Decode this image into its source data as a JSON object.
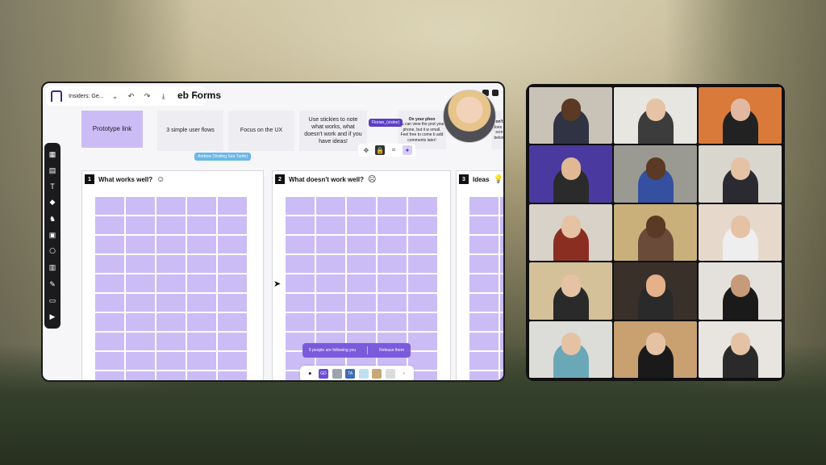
{
  "board": {
    "app_title": "Insiders: Ge...",
    "board_title": "eb Forms",
    "stickies": {
      "prototype_link": "Prototype link",
      "user_flows": "3 simple user flows",
      "focus_ux": "Focus on the UX",
      "use_stickies": "Use stickies to note what works, what doesn't work and if you have ideas!",
      "phone_a": "On your phon",
      "phone_b": "ou can view the prot your phone, but it w small. Feel free to come b add comments later!",
      "partial_a": "on't",
      "partial_b": "Joes e scre below"
    },
    "cursor_labels": {
      "andrew": "Andrew (Visiting Sea Turtle)",
      "florian": "Florian_(visitor)"
    },
    "columns": [
      {
        "num": "1",
        "title": "What works well?",
        "emoji": "☺"
      },
      {
        "num": "2",
        "title": "What doesn't work well?",
        "emoji": "☹"
      },
      {
        "num": "3",
        "title": "Ideas",
        "emoji": "💡"
      }
    ],
    "follow_banner": {
      "text": "5 people are following you",
      "action": "Release them"
    },
    "avatars": [
      "☻",
      "GD",
      "",
      "TA",
      "",
      "",
      "",
      "›"
    ]
  },
  "colors": {
    "accent": "#7a5bdb",
    "sticky_purple": "#cbbcf6",
    "toolbar_dark": "#1b1b1d"
  },
  "icons": {
    "left_toolbar": [
      "frames-icon",
      "sticky-note-icon",
      "text-icon",
      "shapes-icon",
      "llama-icon",
      "image-icon",
      "diagram-icon",
      "table-icon",
      "pen-icon",
      "archive-icon",
      "present-icon"
    ],
    "top_toolbar": [
      "undo-icon",
      "redo-icon",
      "download-icon",
      "search-icon",
      "lightning-icon"
    ]
  }
}
